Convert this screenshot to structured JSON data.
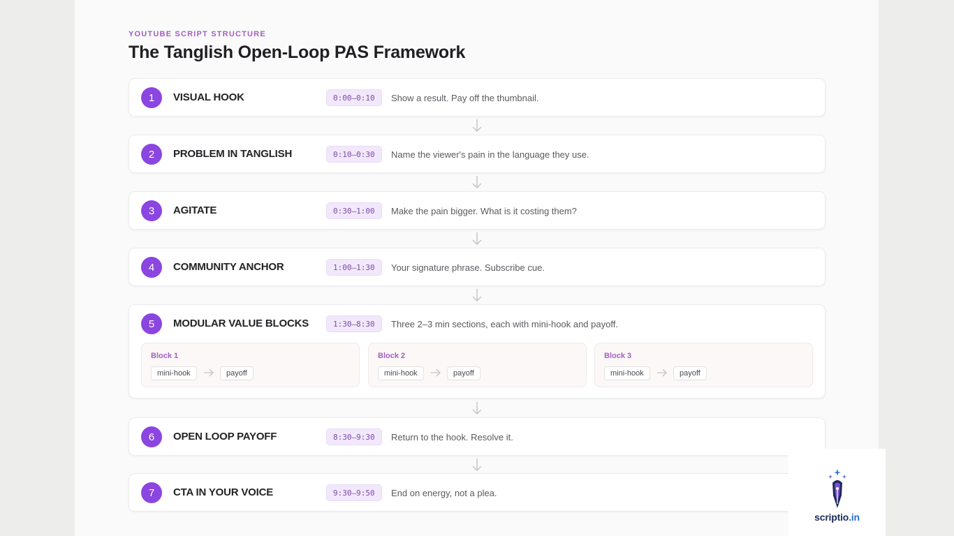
{
  "header": {
    "eyebrow": "YOUTUBE SCRIPT STRUCTURE",
    "title": "The Tanglish Open-Loop PAS Framework"
  },
  "steps": [
    {
      "number": "1",
      "label": "VISUAL HOOK",
      "time": "0:00–0:10",
      "description": "Show a result. Pay off the thumbnail."
    },
    {
      "number": "2",
      "label": "PROBLEM IN TANGLISH",
      "time": "0:10–0:30",
      "description": "Name the viewer's pain in the language they use."
    },
    {
      "number": "3",
      "label": "AGITATE",
      "time": "0:30–1:00",
      "description": "Make the pain bigger. What is it costing them?"
    },
    {
      "number": "4",
      "label": "COMMUNITY ANCHOR",
      "time": "1:00–1:30",
      "description": "Your signature phrase. Subscribe cue."
    },
    {
      "number": "5",
      "label": "MODULAR VALUE BLOCKS",
      "time": "1:30–8:30",
      "description": "Three 2–3 min sections, each with mini-hook and payoff.",
      "blocks": [
        {
          "title": "Block 1",
          "start": "mini-hook",
          "end": "payoff"
        },
        {
          "title": "Block 2",
          "start": "mini-hook",
          "end": "payoff"
        },
        {
          "title": "Block 3",
          "start": "mini-hook",
          "end": "payoff"
        }
      ]
    },
    {
      "number": "6",
      "label": "OPEN LOOP PAYOFF",
      "time": "8:30–9:30",
      "description": "Return to the hook. Resolve it."
    },
    {
      "number": "7",
      "label": "CTA IN YOUR VOICE",
      "time": "9:30–9:50",
      "description": "End on energy, not a plea."
    }
  ],
  "logo": {
    "name": "scriptio",
    "tld": ".in",
    "icon": "quill-pen-icon"
  },
  "colors": {
    "accent": "#8b45e0",
    "eyebrow": "#a45ec4",
    "time_badge_bg": "#f2e8fb"
  }
}
